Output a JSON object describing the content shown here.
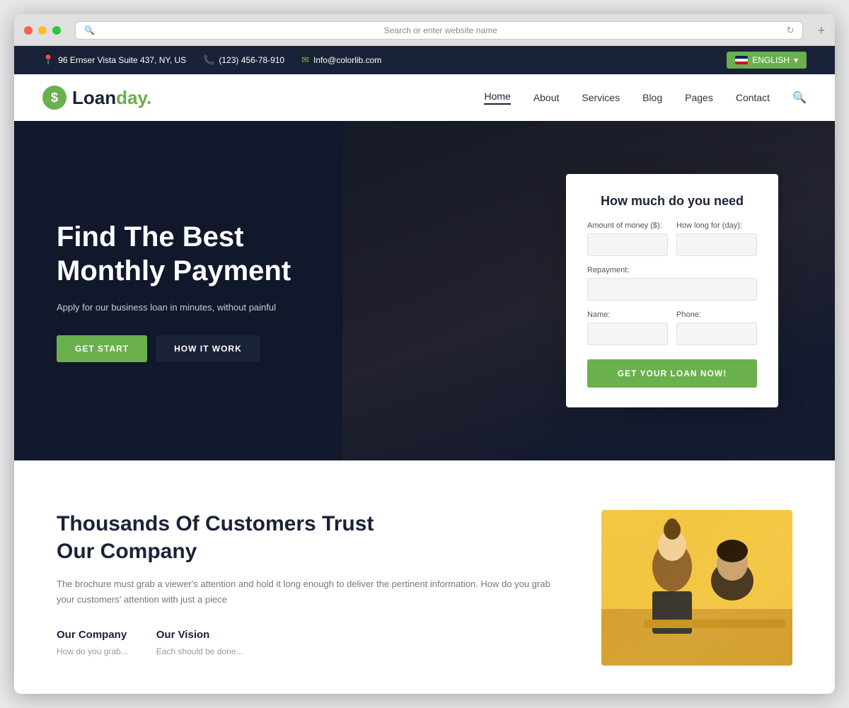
{
  "browser": {
    "address_placeholder": "Search or enter website name",
    "new_tab": "+"
  },
  "contact_bar": {
    "address": "96 Ernser Vista Suite 437, NY, US",
    "phone": "(123) 456-78-910",
    "email": "Info@colorlib.com",
    "language": "ENGLISH"
  },
  "navbar": {
    "logo_text": "Loan",
    "logo_dot": "day.",
    "logo_symbol": "$",
    "links": [
      {
        "label": "Home",
        "active": true
      },
      {
        "label": "About",
        "active": false
      },
      {
        "label": "Services",
        "active": false
      },
      {
        "label": "Blog",
        "active": false
      },
      {
        "label": "Pages",
        "active": false
      },
      {
        "label": "Contact",
        "active": false
      }
    ]
  },
  "hero": {
    "title": "Find The Best\nMonthly Payment",
    "subtitle": "Apply for our business loan in minutes, without painful",
    "btn_start": "GET START",
    "btn_how": "HOW IT WORK"
  },
  "loan_form": {
    "title": "How much do you need",
    "amount_label": "Amount of money ($):",
    "amount_placeholder": "",
    "duration_label": "How long for (day):",
    "duration_placeholder": "",
    "repayment_label": "Repayment:",
    "repayment_placeholder": "",
    "name_label": "Name:",
    "name_placeholder": "",
    "phone_label": "Phone:",
    "phone_placeholder": "",
    "submit_btn": "GET YOUR LOAN NOW!"
  },
  "about": {
    "title": "Thousands Of Customers Trust\nOur Company",
    "description": "The brochure must grab a viewer's attention and hold it long enough to deliver the pertinent information. How do you grab your customers' attention with just a piece",
    "col1_title": "Our Company",
    "col1_text": "How do you grab...",
    "col2_title": "Our Vision",
    "col2_text": "Each should be done..."
  }
}
